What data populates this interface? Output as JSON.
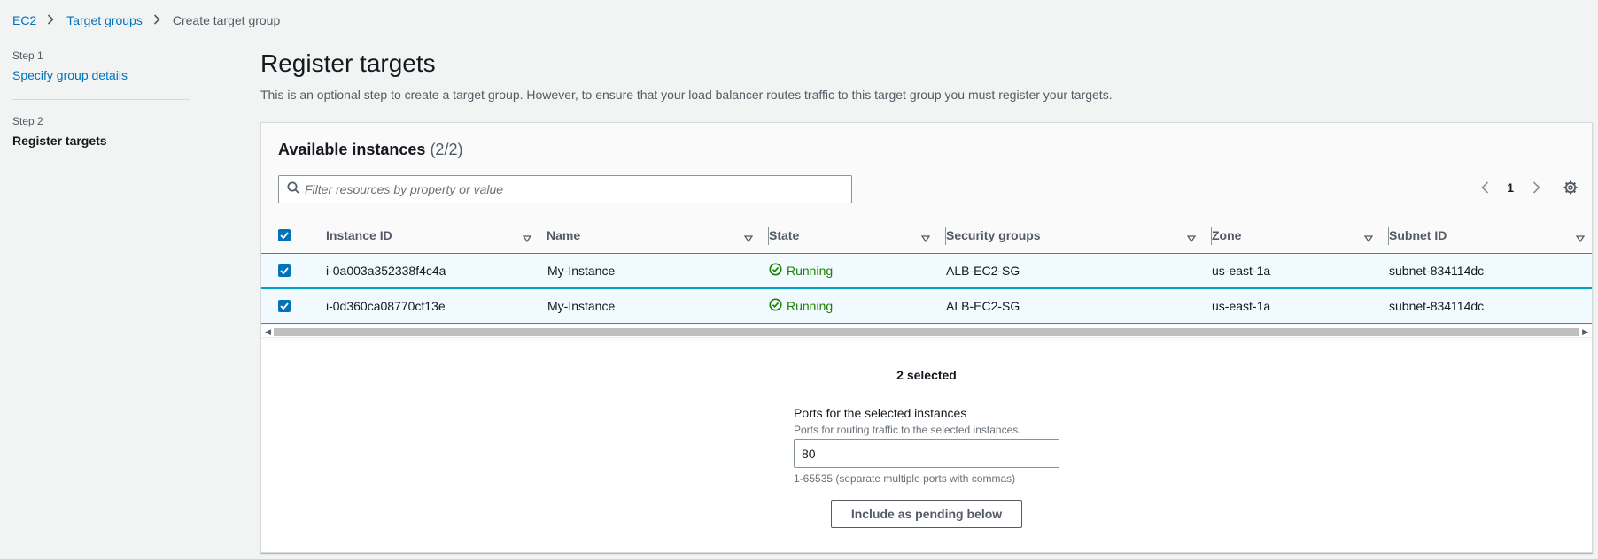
{
  "breadcrumb": [
    {
      "label": "EC2"
    },
    {
      "label": "Target groups"
    },
    {
      "label": "Create target group"
    }
  ],
  "steps": [
    {
      "step": "Step 1",
      "label": "Specify group details"
    },
    {
      "step": "Step 2",
      "label": "Register targets"
    }
  ],
  "page": {
    "title": "Register targets",
    "description": "This is an optional step to create a target group. However, to ensure that your load balancer routes traffic to this target group you must register your targets."
  },
  "instances": {
    "title": "Available instances",
    "count": "(2/2)",
    "search_placeholder": "Filter resources by property or value",
    "page": "1",
    "columns": [
      "Instance ID",
      "Name",
      "State",
      "Security groups",
      "Zone",
      "Subnet ID"
    ],
    "rows": [
      {
        "id": "i-0a003a352338f4c4a",
        "name": "My-Instance",
        "state": "Running",
        "sg": "ALB-EC2-SG",
        "zone": "us-east-1a",
        "subnet": "subnet-834114dc"
      },
      {
        "id": "i-0d360ca08770cf13e",
        "name": "My-Instance",
        "state": "Running",
        "sg": "ALB-EC2-SG",
        "zone": "us-east-1a",
        "subnet": "subnet-834114dc"
      }
    ]
  },
  "selection": {
    "count_text": "2 selected",
    "ports_label": "Ports for the selected instances",
    "ports_desc": "Ports for routing traffic to the selected instances.",
    "ports_value": "80",
    "ports_hint": "1-65535 (separate multiple ports with commas)",
    "include_button": "Include as pending below"
  },
  "colors": {
    "link": "#0073bb",
    "running": "#1d8102",
    "selected_row": "#f1faff",
    "checkbox": "#0073bb"
  }
}
